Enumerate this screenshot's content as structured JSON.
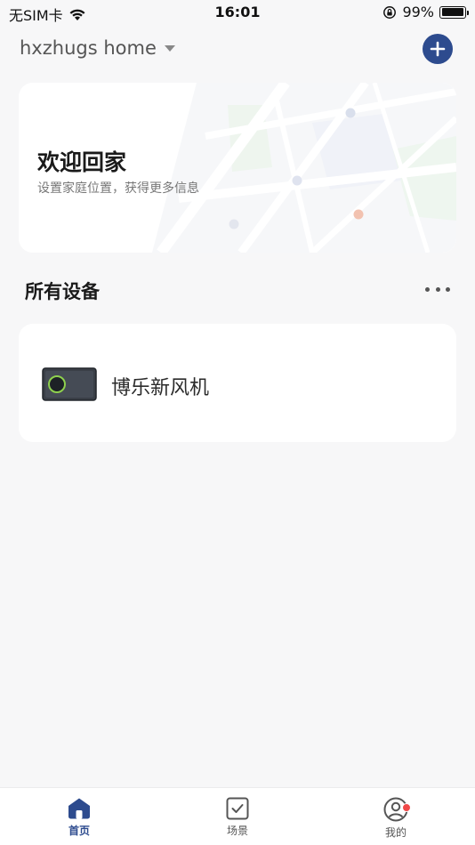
{
  "status_bar": {
    "carrier": "无SIM卡",
    "time": "16:01",
    "battery": "99%",
    "battery_level": 0.99
  },
  "header": {
    "home_name": "hxzhugs home",
    "accent_color": "#2d4b8e"
  },
  "welcome": {
    "title": "欢迎回家",
    "subtitle": "设置家庭位置，获得更多信息"
  },
  "devices_section": {
    "title": "所有设备",
    "items": [
      {
        "name": "博乐新风机"
      }
    ]
  },
  "tab_bar": {
    "tabs": [
      {
        "label": "首页",
        "icon": "home-icon",
        "active": true
      },
      {
        "label": "场景",
        "icon": "checkbox-icon",
        "active": false
      },
      {
        "label": "我的",
        "icon": "user-icon",
        "active": false
      }
    ]
  }
}
